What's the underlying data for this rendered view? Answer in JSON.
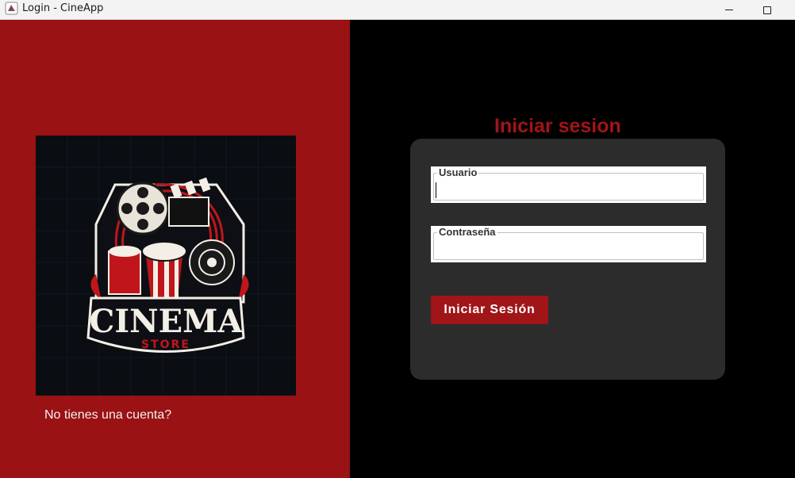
{
  "window": {
    "title": "Login - CineApp"
  },
  "colors": {
    "brand_red": "#9a1214",
    "accent_red": "#a01518",
    "card": "#2c2c2c",
    "background": "#000000"
  },
  "logo": {
    "main_text": "CINEMA",
    "sub_text": "STORE"
  },
  "signup": {
    "text": "No tienes una cuenta?"
  },
  "login": {
    "title": "Iniciar sesion",
    "user_label": "Usuario",
    "user_value": "",
    "password_label": "Contraseña",
    "password_value": "",
    "button_label": "Iniciar Sesión"
  }
}
